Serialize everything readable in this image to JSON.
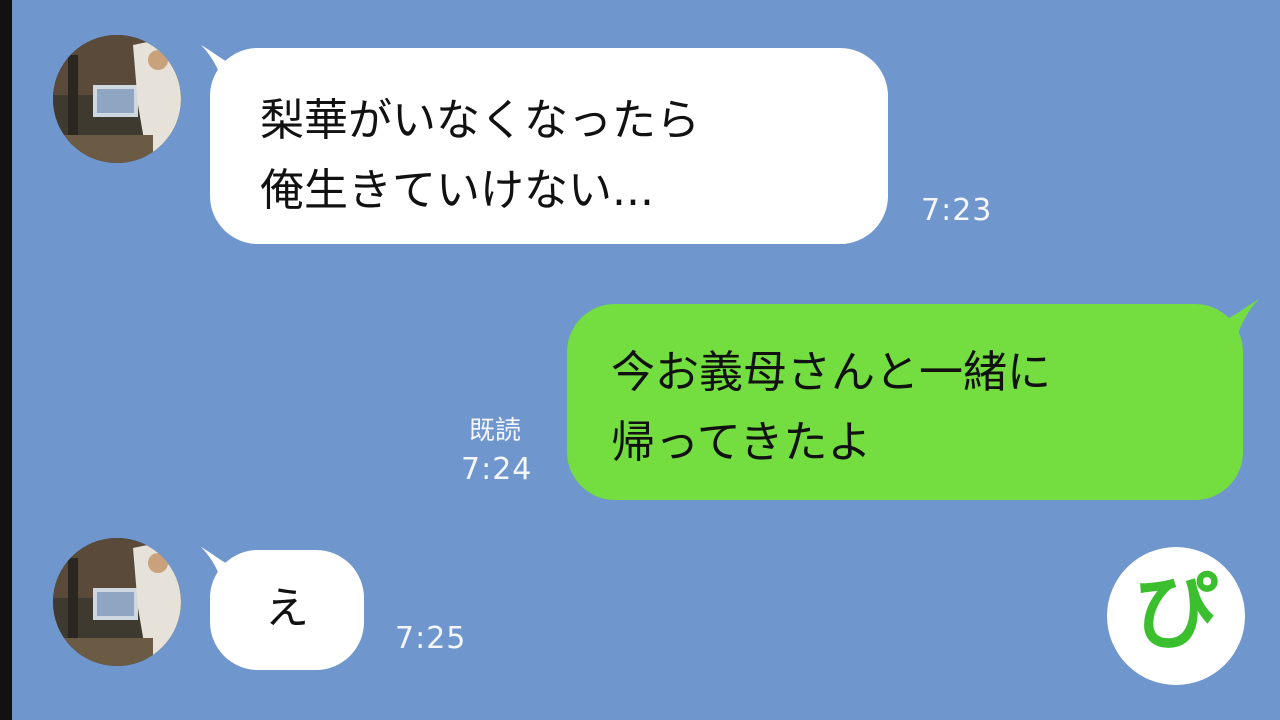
{
  "chat": {
    "messages": [
      {
        "sender": "other",
        "text": "梨華がいなくなったら\n俺生きていけない...",
        "time": "7:23"
      },
      {
        "sender": "self",
        "text": "今お義母さんと一緒に\n帰ってきたよ",
        "read_label": "既読",
        "time": "7:24"
      },
      {
        "sender": "other",
        "text": "え",
        "time": "7:25"
      }
    ]
  },
  "logo": {
    "text": "ぴ"
  },
  "colors": {
    "background": "#6f97cd",
    "incoming_bubble": "#ffffff",
    "outgoing_bubble": "#74dd3f",
    "logo_text": "#3cbf2e"
  },
  "icons": [
    "contact-avatar",
    "app-logo"
  ]
}
